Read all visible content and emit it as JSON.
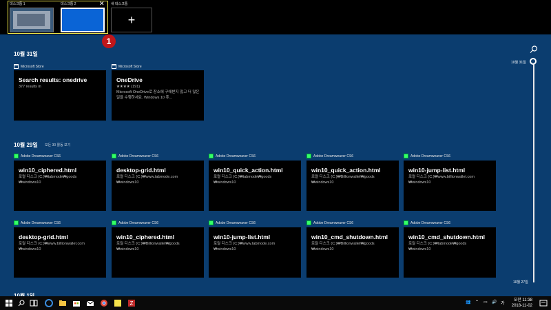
{
  "desktops": {
    "desktop1_label": "데스크톱 1",
    "desktop2_label": "데스크톱 2",
    "new_desktop_label": "새 데스크톱",
    "close_glyph": "✕",
    "plus_glyph": "+",
    "badge_number": "1"
  },
  "colors": {
    "background": "#0b3d6f",
    "topbar": "#000000",
    "active_group_border": "#f1e94a",
    "badge": "#c0161a",
    "desktop2_thumb": "#0a64d6"
  },
  "sections": [
    {
      "date": "10월 31일",
      "see_all": "",
      "items": [
        {
          "app": "Microsoft Store",
          "icon": "store-icon",
          "title": "Search results: onedrive",
          "sub": "377 results in"
        },
        {
          "app": "Microsoft Store",
          "icon": "store-icon",
          "title": "OneDrive",
          "sub": "★★★★ (191)\nMicrosoft OneDrive로 장소에 구애받지 않고 더 많은 일을 수행하세요. Windows 10 휴..."
        }
      ]
    },
    {
      "date": "10월 29일",
      "see_all": "모든 30 활동 보기",
      "items": [
        {
          "app": "Adobe Dreamweaver CS6",
          "icon": "dreamweaver-icon",
          "title": "win10_ciphered.html",
          "sub": "로컬 디스크 (C:)₩tabmode₩goods\n₩windows10"
        },
        {
          "app": "Adobe Dreamweaver CS6",
          "icon": "dreamweaver-icon",
          "title": "desktop-grid.html",
          "sub": "로컬 디스크 (C:)₩www.tabmode.com\n₩windows10"
        },
        {
          "app": "Adobe Dreamweaver CS6",
          "icon": "dreamweaver-icon",
          "title": "win10_quick_action.html",
          "sub": "로컬 디스크 (C:)₩tabmode₩goods\n₩windows10"
        },
        {
          "app": "Adobe Dreamweaver CS6",
          "icon": "dreamweaver-icon",
          "title": "win10_quick_action.html",
          "sub": "로컬 디스크 (C:)₩Billionwallet₩goods\n₩windows10"
        },
        {
          "app": "Adobe Dreamweaver CS6",
          "icon": "dreamweaver-icon",
          "title": "win10-jump-list.html",
          "sub": "로컬 디스크 (C:)₩www.billionwallet.com\n₩windows10"
        },
        {
          "app": "Adobe Dreamweaver CS6",
          "icon": "dreamweaver-icon",
          "title": "desktop-grid.html",
          "sub": "로컬 디스크 (C:)₩www.billionwallet.com\n₩windows10"
        },
        {
          "app": "Adobe Dreamweaver CS6",
          "icon": "dreamweaver-icon",
          "title": "win10_ciphered.html",
          "sub": "로컬 디스크 (C:)₩Billionwallet₩goods\n₩windows10"
        },
        {
          "app": "Adobe Dreamweaver CS6",
          "icon": "dreamweaver-icon",
          "title": "win10-jump-list.html",
          "sub": "로컬 디스크 (C:)₩www.tabmode.com\n₩windows10"
        },
        {
          "app": "Adobe Dreamweaver CS6",
          "icon": "dreamweaver-icon",
          "title": "win10_cmd_shutdown.html",
          "sub": "로컬 디스크 (C:)₩Billionwallet₩goods\n₩windows10"
        },
        {
          "app": "Adobe Dreamweaver CS6",
          "icon": "dreamweaver-icon",
          "title": "win10_cmd_shutdown.html",
          "sub": "로컬 디스크 (C:)₩tabmode₩goods\n₩windows10"
        }
      ]
    }
  ],
  "partial_next_date": "10월 1일",
  "timeline": {
    "top_label": "10월 31일",
    "bottom_label": "10월 27일"
  },
  "taskbar": {
    "icons": [
      "windows-start-icon",
      "search-icon",
      "task-view-icon",
      "edge-icon",
      "file-explorer-icon",
      "store-icon",
      "mail-icon",
      "chrome-icon",
      "sticky-notes-icon",
      "filezilla-icon"
    ],
    "tray_icons": [
      "people-icon",
      "chevron-up-icon",
      "network-icon",
      "volume-icon",
      "ime-icon",
      "action-center-icon"
    ],
    "ime_label": "가",
    "time": "오전 11:38",
    "date": "2018-11-02"
  }
}
